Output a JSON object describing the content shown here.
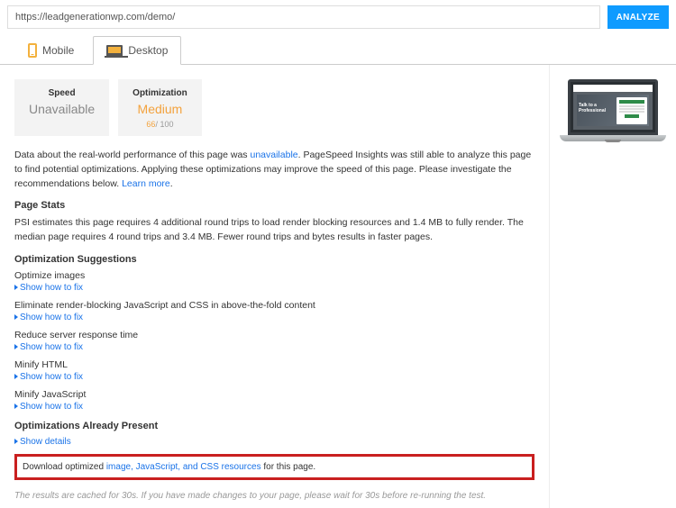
{
  "url": "https://leadgenerationwp.com/demo/",
  "analyze_label": "ANALYZE",
  "tabs": {
    "mobile": "Mobile",
    "desktop": "Desktop"
  },
  "cards": {
    "speed": {
      "label": "Speed",
      "value": "Unavailable"
    },
    "optimization": {
      "label": "Optimization",
      "value": "Medium",
      "score": "66",
      "score_max": "/ 100"
    }
  },
  "intro": {
    "pre": "Data about the real-world performance of this page was ",
    "unavail": "unavailable",
    "mid": ". PageSpeed Insights was still able to analyze this page to find potential optimizations. Applying these optimizations may improve the speed of this page. Please investigate the recommendations below. ",
    "learn": "Learn more",
    "end": "."
  },
  "page_stats": {
    "heading": "Page Stats",
    "text": "PSI estimates this page requires 4 additional round trips to load render blocking resources and 1.4 MB to fully render. The median page requires 4 round trips and 3.4 MB. Fewer round trips and bytes results in faster pages."
  },
  "suggestions_heading": "Optimization Suggestions",
  "show_fix": "Show how to fix",
  "suggestions": [
    "Optimize images",
    "Eliminate render-blocking JavaScript and CSS in above-the-fold content",
    "Reduce server response time",
    "Minify HTML",
    "Minify JavaScript"
  ],
  "already": {
    "heading": "Optimizations Already Present",
    "show_details": "Show details"
  },
  "download": {
    "pre": "Download optimized ",
    "link": "image, JavaScript, and CSS resources",
    "post": " for this page."
  },
  "footer": "The results are cached for 30s. If you have made changes to your page, please wait for 30s before re-running the test.",
  "mock": {
    "hero_line1": "Talk to a",
    "hero_line2": "Professional"
  }
}
